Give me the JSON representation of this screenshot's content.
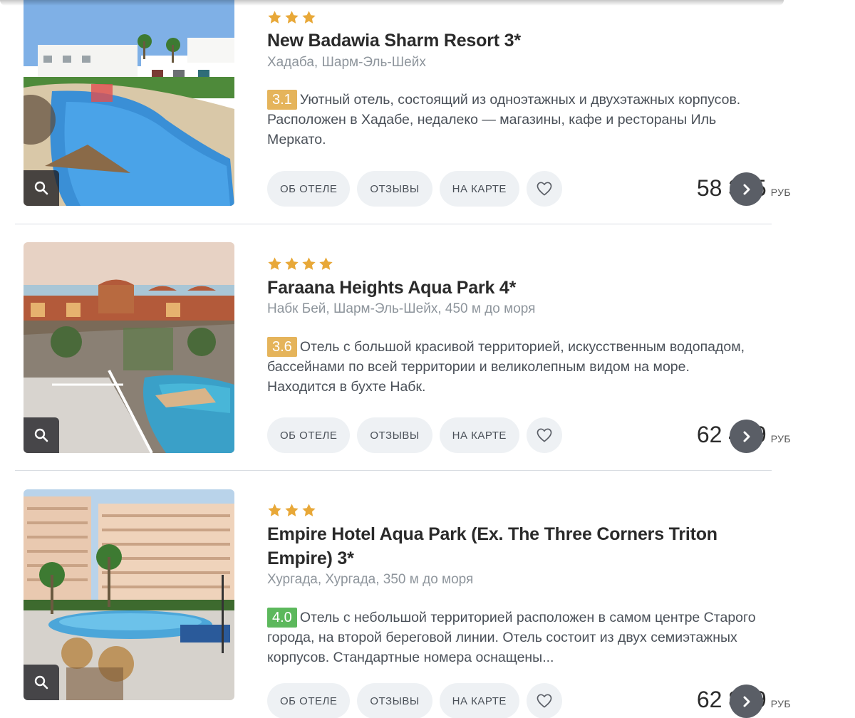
{
  "labels": {
    "about": "ОБ ОТЕЛЕ",
    "reviews": "ОТЗЫВЫ",
    "map": "НА КАРТЕ",
    "currency": "РУБ"
  },
  "colors": {
    "star": "#E8A838",
    "rating_yellow": "#E5B45B",
    "rating_green": "#5CB85C",
    "go_button": "#5A5E66",
    "pill_bg": "#EEF1F4"
  },
  "hotels": [
    {
      "stars": 3,
      "name": "New Badawia Sharm Resort 3*",
      "location": "Хадаба, Шарм-Эль-Шейх",
      "rating": "3.1",
      "rating_color": "#E5B45B",
      "description": "Уютный отель, состоящий из одноэтажных и двухэтажных корпусов. Расположен в Хадабе, недалеко — магазины, кафе и рестораны Иль Меркато.",
      "price": "58 385"
    },
    {
      "stars": 4,
      "name": "Faraana Heights Aqua Park 4*",
      "location": "Набк Бей, Шарм-Эль-Шейх, 450 м до моря",
      "rating": "3.6",
      "rating_color": "#E5B45B",
      "description": "Отель с большой красивой территорией, искусственным водопадом, бассейнами по всей территории и великолепным видом на море. Находится в бухте Набк.",
      "price": "62 449"
    },
    {
      "stars": 3,
      "name": "Empire Hotel Aqua Park (Ex. The Three Corners Triton Empire) 3*",
      "location": "Хургада, Хургада, 350 м до моря",
      "rating": "4.0",
      "rating_color": "#5CB85C",
      "description": "Отель с небольшой территорией расположен в самом центре Старого города, на второй береговой линии. Отель состоит из двух семиэтажных корпусов. Стандартные номера оснащены...",
      "price": "62 819"
    }
  ]
}
